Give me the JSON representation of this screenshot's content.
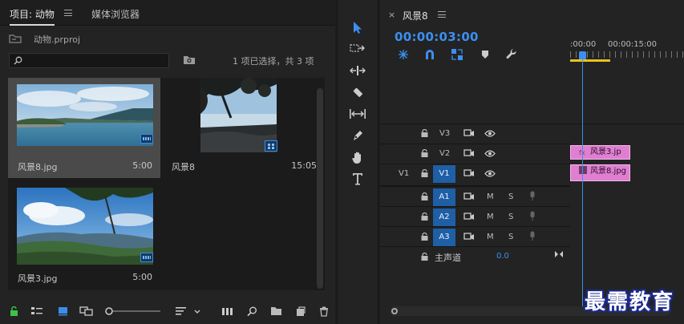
{
  "project_panel": {
    "tabs": [
      {
        "label": "项目: 动物",
        "active": true
      },
      {
        "label": "媒体浏览器",
        "active": false
      }
    ],
    "project_file": "动物.prproj",
    "search": {
      "value": "",
      "placeholder": ""
    },
    "selection_status": "1 项已选择，共 3 项",
    "items": [
      {
        "name": "风景8.jpg",
        "duration": "5:00",
        "selected": true
      },
      {
        "name": "风景8",
        "duration": "15:05",
        "selected": false
      },
      {
        "name": "风景3.jpg",
        "duration": "5:00",
        "selected": false
      }
    ],
    "bottom_icons": [
      "lock-icon",
      "list-view-icon",
      "icon-view-icon",
      "freeform-view-icon",
      "zoom-slider",
      "sort-icon",
      "automate-icon",
      "find-icon",
      "new-bin-icon",
      "new-item-icon",
      "clear-icon"
    ]
  },
  "tools": [
    "selection-tool",
    "track-select-tool",
    "ripple-edit-tool",
    "razor-tool",
    "slip-tool",
    "pen-tool",
    "hand-tool",
    "type-tool"
  ],
  "timeline": {
    "sequence_name": "风景8",
    "timecode": "00:00:03:00",
    "ruler_labels": [
      ":00:00",
      "00:00:15:00"
    ],
    "video_tracks": [
      {
        "name": "V3",
        "source": ""
      },
      {
        "name": "V2",
        "source": ""
      },
      {
        "name": "V1",
        "source": "V1"
      }
    ],
    "audio_tracks": [
      {
        "name": "A1",
        "mute": "M",
        "solo": "S"
      },
      {
        "name": "A2",
        "mute": "M",
        "solo": "S"
      },
      {
        "name": "A3",
        "mute": "M",
        "solo": "S"
      }
    ],
    "master": {
      "label": "主声道",
      "value": "0.0"
    },
    "clips": [
      {
        "track": "V2",
        "label": "风景3.jp"
      },
      {
        "track": "V1",
        "label": "风景8.jpg"
      }
    ],
    "colors": {
      "accent": "#3c8ff0",
      "clip": "#e07fd1",
      "target": "#1e5fa6"
    }
  },
  "watermark": "最需教育"
}
